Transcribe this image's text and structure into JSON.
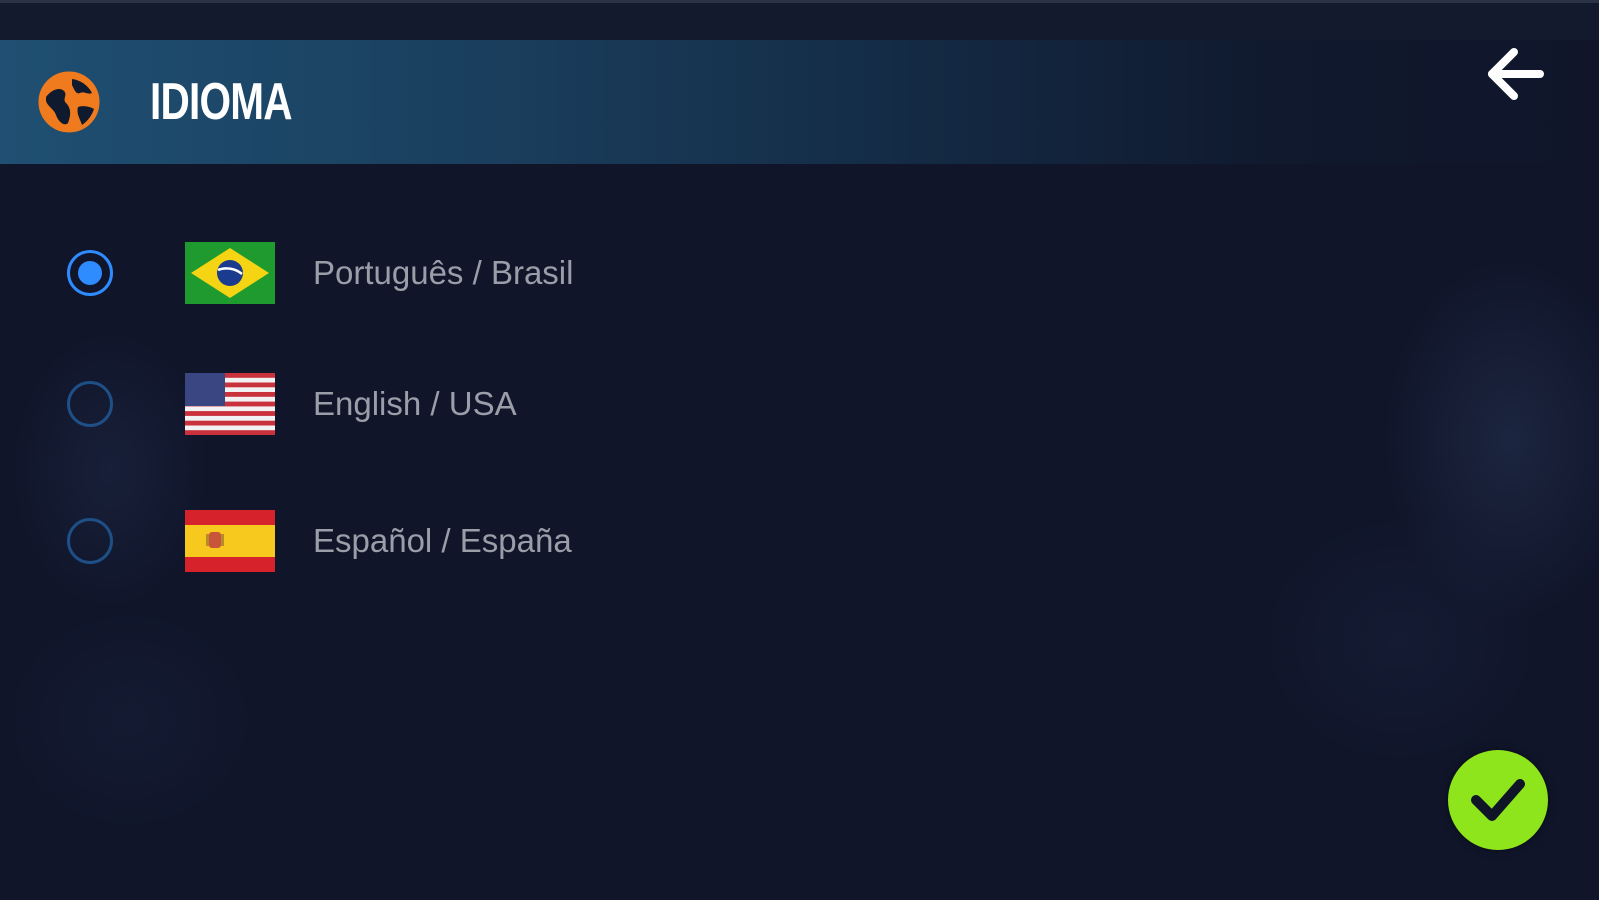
{
  "screen": {
    "title": "IDIOMA"
  },
  "icons": {
    "header": "globe-icon",
    "back": "arrow-left-icon",
    "confirm": "checkmark-icon"
  },
  "languages": [
    {
      "label": "Português / Brasil",
      "flag": "brazil-flag-icon",
      "selected": true
    },
    {
      "label": "English / USA",
      "flag": "usa-flag-icon",
      "selected": false
    },
    {
      "label": "Español / España",
      "flag": "spain-flag-icon",
      "selected": false
    }
  ],
  "colors": {
    "accent_orange": "#f07a1e",
    "radio_selected": "#2e8cff",
    "radio_unselected": "#1e4f86",
    "confirm_green": "#8ee51b",
    "background": "#10152a"
  }
}
